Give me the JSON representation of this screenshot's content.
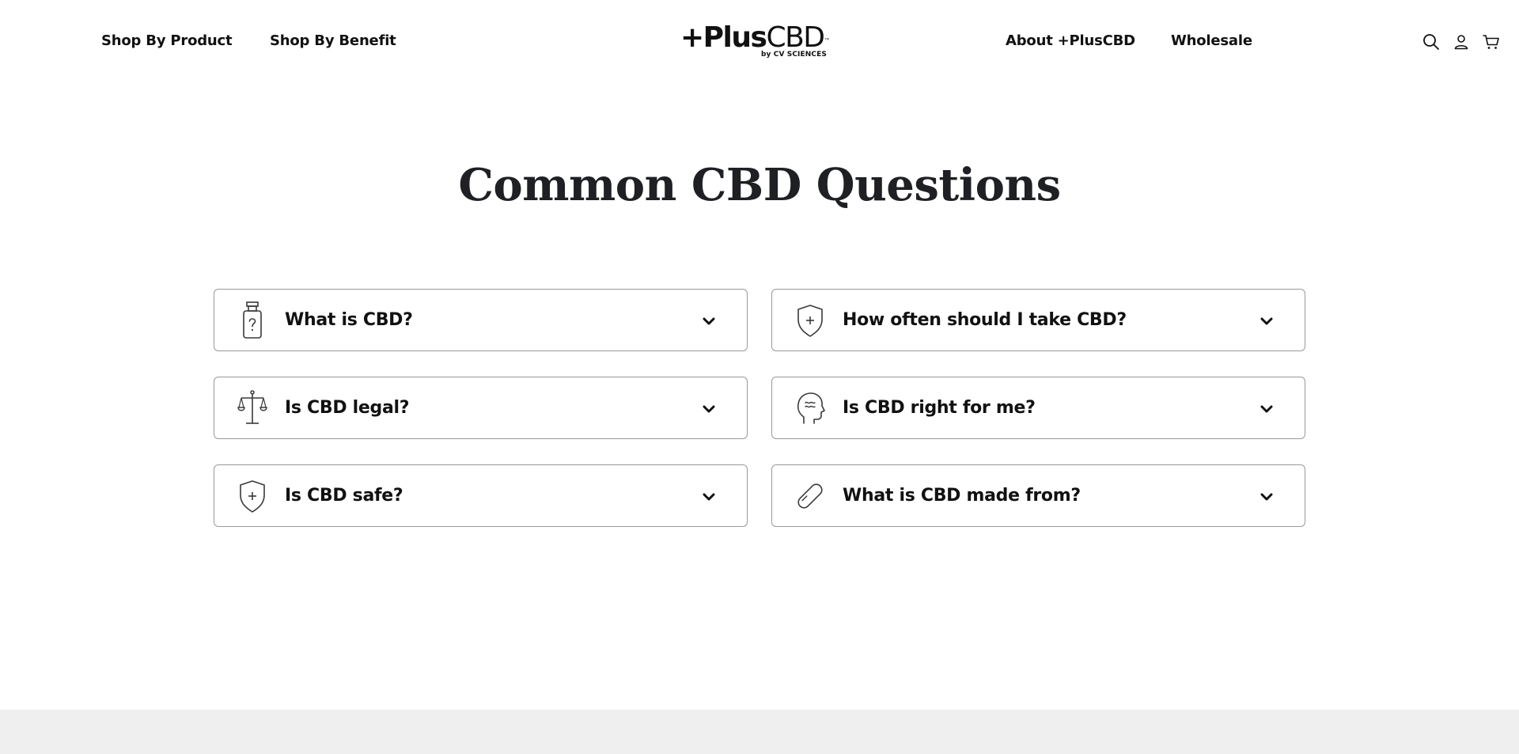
{
  "nav": {
    "left": [
      "Shop By Product",
      "Shop By Benefit"
    ],
    "right": [
      "About +PlusCBD",
      "Wholesale"
    ]
  },
  "logo": {
    "plus": "+Plus",
    "cbd": "CBD",
    "tm": "™",
    "tagline": "by CV SCIENCES"
  },
  "header_icons": [
    "search-icon",
    "account-icon",
    "cart-icon"
  ],
  "section": {
    "title": "Common CBD Questions"
  },
  "faqs": [
    {
      "question": "What is CBD?",
      "icon": "bottle-question-icon"
    },
    {
      "question": "How often should I take CBD?",
      "icon": "shield-plus-icon"
    },
    {
      "question": "Is CBD legal?",
      "icon": "scales-icon"
    },
    {
      "question": "Is CBD right for me?",
      "icon": "head-profile-icon"
    },
    {
      "question": "Is CBD safe?",
      "icon": "shield-plus-icon"
    },
    {
      "question": "What is CBD made from?",
      "icon": "capsule-icon"
    }
  ],
  "colors": {
    "text": "#111111",
    "title": "#1f2024",
    "card_border": "#9a9a9a",
    "footer_band": "#efefef",
    "icon_stroke": "#3a3a3a"
  }
}
